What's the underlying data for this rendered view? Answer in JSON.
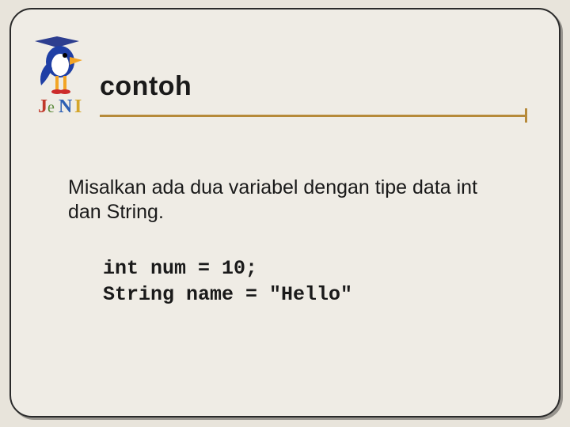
{
  "header": {
    "title": "contoh"
  },
  "logo": {
    "name": "jeni-mascot-logo",
    "text": "JeNI"
  },
  "content": {
    "paragraph": "Misalkan ada dua variabel dengan tipe data int dan String.",
    "code_line1": "int num = 10;",
    "code_line2": "String name = \"Hello\""
  },
  "colors": {
    "accent": "#b68a3a",
    "frame_border": "#2a2a2a",
    "slide_bg": "#efece5",
    "outer_bg": "#e8e4db"
  }
}
